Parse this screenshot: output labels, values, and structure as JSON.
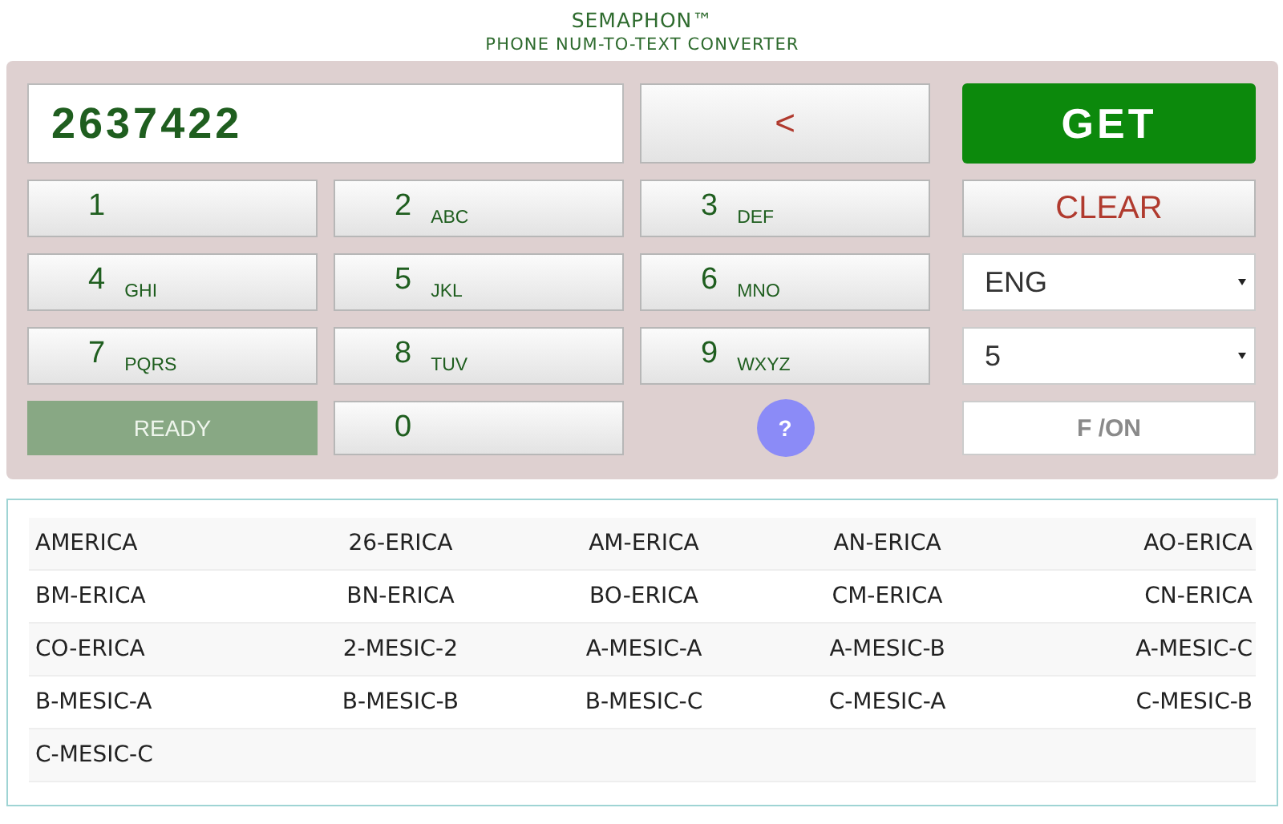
{
  "header": {
    "title": "SEMAPHON™",
    "subtitle": "PHONE NUM-TO-TEXT CONVERTER"
  },
  "number_field": {
    "value": "2637422"
  },
  "backspace_button": "<",
  "get_button": "GET",
  "keys": [
    {
      "digit": "1"
    },
    {
      "digit": "2",
      "letters": "ABC"
    },
    {
      "digit": "3",
      "letters": "DEF"
    },
    {
      "digit": "4",
      "letters": "GHI"
    },
    {
      "digit": "5",
      "letters": "JKL"
    },
    {
      "digit": "6",
      "letters": "MNO"
    },
    {
      "digit": "7",
      "letters": "PQRS"
    },
    {
      "digit": "8",
      "letters": "TUV"
    },
    {
      "digit": "9",
      "letters": "WXYZ"
    },
    {
      "digit": "0"
    }
  ],
  "clear_button": "CLEAR",
  "language_select": "ENG",
  "count_select": "5",
  "status": "READY",
  "help_button": "?",
  "filter_toggle": "F /ON",
  "results": [
    [
      "AMERICA",
      "26-ERICA",
      "AM-ERICA",
      "AN-ERICA",
      "AO-ERICA"
    ],
    [
      "BM-ERICA",
      "BN-ERICA",
      "BO-ERICA",
      "CM-ERICA",
      "CN-ERICA"
    ],
    [
      "CO-ERICA",
      "2-MESIC-2",
      "A-MESIC-A",
      "A-MESIC-B",
      "A-MESIC-C"
    ],
    [
      "B-MESIC-A",
      "B-MESIC-B",
      "B-MESIC-C",
      "C-MESIC-A",
      "C-MESIC-B"
    ],
    [
      "C-MESIC-C"
    ]
  ]
}
